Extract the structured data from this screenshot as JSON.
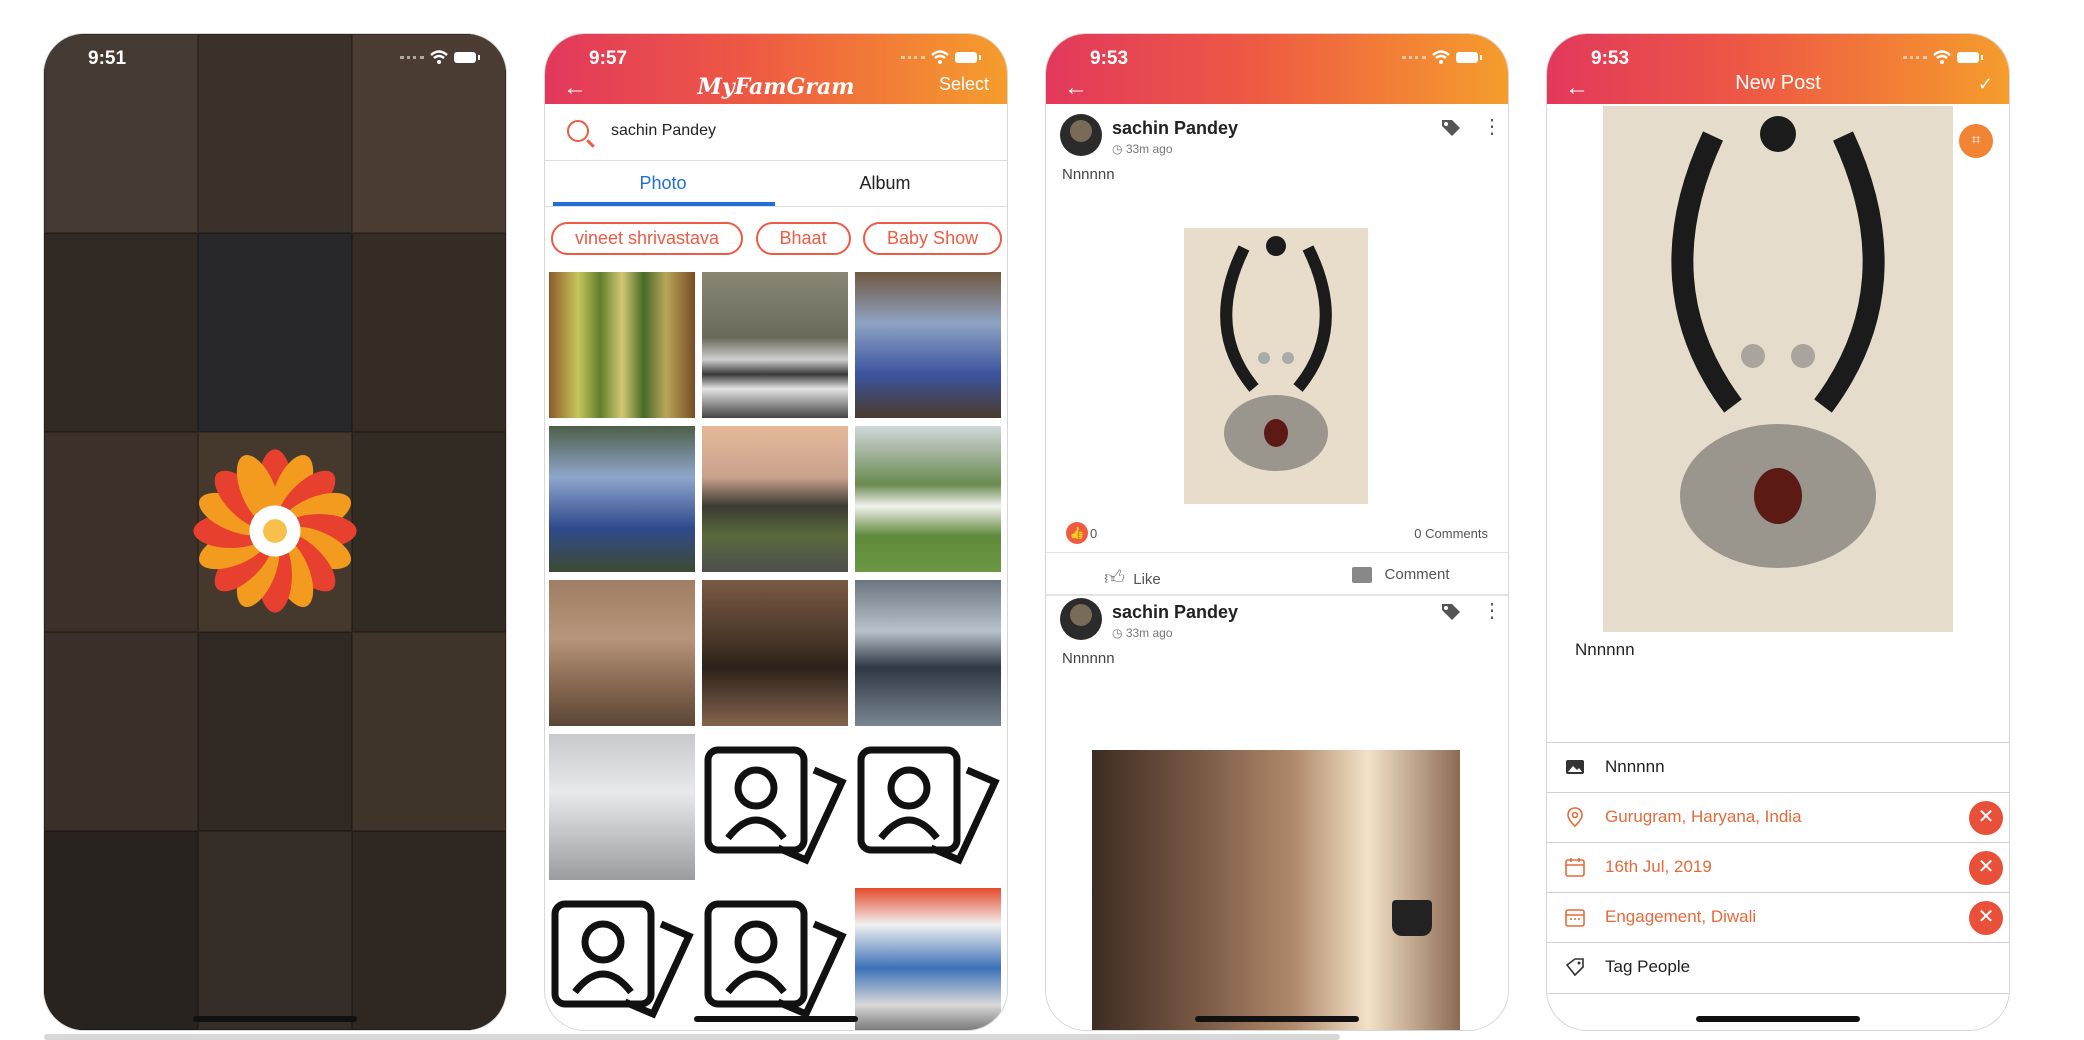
{
  "screens": [
    {
      "id": "splash",
      "status_time": "9:51"
    },
    {
      "id": "search",
      "status_time": "9:57",
      "app_title": "MyFamGram",
      "nav_right": "Select",
      "search_value": "sachin Pandey",
      "tabs": [
        "Photo",
        "Album"
      ],
      "chips": [
        "vineet shrivastava",
        "Bhaat",
        "Baby Show"
      ]
    },
    {
      "id": "feed",
      "status_time": "9:53",
      "posts": [
        {
          "author": "sachin Pandey",
          "time_ago": "33m ago",
          "caption": "Nnnnnn",
          "like_count": "0",
          "comments": "0 Comments",
          "like_label": "Like",
          "comment_label": "Comment"
        },
        {
          "author": "sachin Pandey",
          "time_ago": "33m ago",
          "caption": "Nnnnnn"
        }
      ]
    },
    {
      "id": "new_post",
      "status_time": "9:53",
      "title": "New Post",
      "caption": "Nnnnnn",
      "rows": [
        {
          "icon": "image-icon",
          "text": "Nnnnnn"
        },
        {
          "icon": "location-icon",
          "text": "Gurugram, Haryana, India"
        },
        {
          "icon": "calendar-icon",
          "text": "16th Jul, 2019"
        },
        {
          "icon": "event-icon",
          "text": "Engagement, Diwali"
        },
        {
          "icon": "tag-icon",
          "text": "Tag People"
        }
      ]
    }
  ],
  "colors": {
    "accent_start": "#e2385c",
    "accent_end": "#f59d2c",
    "tab_active": "#1f6fd6",
    "chip": "#ee5a43"
  }
}
